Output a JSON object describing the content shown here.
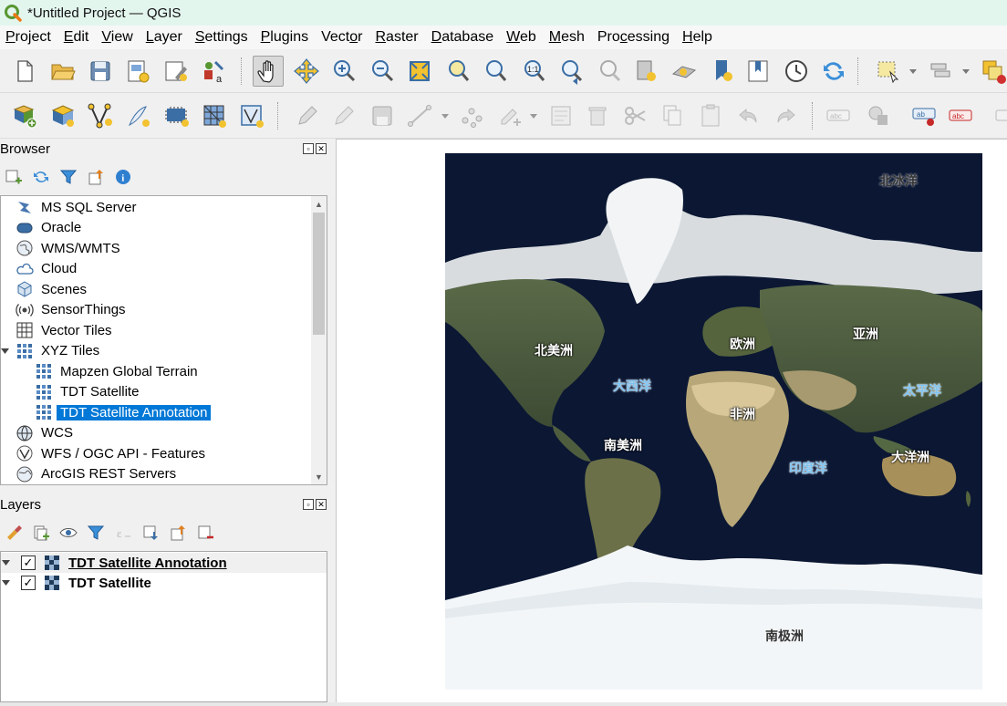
{
  "window": {
    "title": "*Untitled Project — QGIS"
  },
  "menu": [
    {
      "pre": "",
      "key": "P",
      "post": "roject"
    },
    {
      "pre": "",
      "key": "E",
      "post": "dit"
    },
    {
      "pre": "",
      "key": "V",
      "post": "iew"
    },
    {
      "pre": "",
      "key": "L",
      "post": "ayer"
    },
    {
      "pre": "",
      "key": "S",
      "post": "ettings"
    },
    {
      "pre": "",
      "key": "P",
      "post": "lugins"
    },
    {
      "pre": "Vect",
      "key": "o",
      "post": "r"
    },
    {
      "pre": "",
      "key": "R",
      "post": "aster"
    },
    {
      "pre": "",
      "key": "D",
      "post": "atabase"
    },
    {
      "pre": "",
      "key": "W",
      "post": "eb"
    },
    {
      "pre": "",
      "key": "M",
      "post": "esh"
    },
    {
      "pre": "Pro",
      "key": "c",
      "post": "essing"
    },
    {
      "pre": "",
      "key": "H",
      "post": "elp"
    }
  ],
  "browser": {
    "title": "Browser",
    "items": [
      {
        "label": "MS SQL Server",
        "icon": "mssql-icon",
        "indent": 0
      },
      {
        "label": "Oracle",
        "icon": "oracle-icon",
        "indent": 0
      },
      {
        "label": "WMS/WMTS",
        "icon": "wms-globe-icon",
        "indent": 0
      },
      {
        "label": "Cloud",
        "icon": "cloud-icon",
        "indent": 0
      },
      {
        "label": "Scenes",
        "icon": "scenes-cube-icon",
        "indent": 0
      },
      {
        "label": "SensorThings",
        "icon": "sensorthings-icon",
        "indent": 0
      },
      {
        "label": "Vector Tiles",
        "icon": "vector-tiles-icon",
        "indent": 0
      },
      {
        "label": "XYZ Tiles",
        "icon": "xyz-tiles-icon",
        "indent": 0,
        "expanded": true
      },
      {
        "label": "Mapzen Global Terrain",
        "icon": "xyz-tiles-icon",
        "indent": 1
      },
      {
        "label": "TDT Satellite",
        "icon": "xyz-tiles-icon",
        "indent": 1
      },
      {
        "label": "TDT Satellite Annotation",
        "icon": "xyz-tiles-icon",
        "indent": 1,
        "selected": true
      },
      {
        "label": "WCS",
        "icon": "wcs-globe-icon",
        "indent": 0
      },
      {
        "label": "WFS / OGC API - Features",
        "icon": "wfs-icon",
        "indent": 0
      },
      {
        "label": "ArcGIS REST Servers",
        "icon": "arcgis-icon",
        "indent": 0
      }
    ]
  },
  "layers": {
    "title": "Layers",
    "items": [
      {
        "label": "TDT Satellite Annotation",
        "checked": true
      },
      {
        "label": "TDT Satellite",
        "checked": true
      }
    ]
  },
  "map": {
    "labels": {
      "arctic": "北冰洋",
      "north_america": "北美洲",
      "europe": "欧洲",
      "asia": "亚洲",
      "atlantic": "大西洋",
      "pacific": "太平洋",
      "africa": "非洲",
      "south_america": "南美洲",
      "indian": "印度洋",
      "oceania": "大洋洲",
      "antarctica": "南极洲"
    }
  },
  "colors": {
    "selection": "#0078d7",
    "ocean_label": "#7fc3f0",
    "title_bar": "#e3f6ee"
  }
}
